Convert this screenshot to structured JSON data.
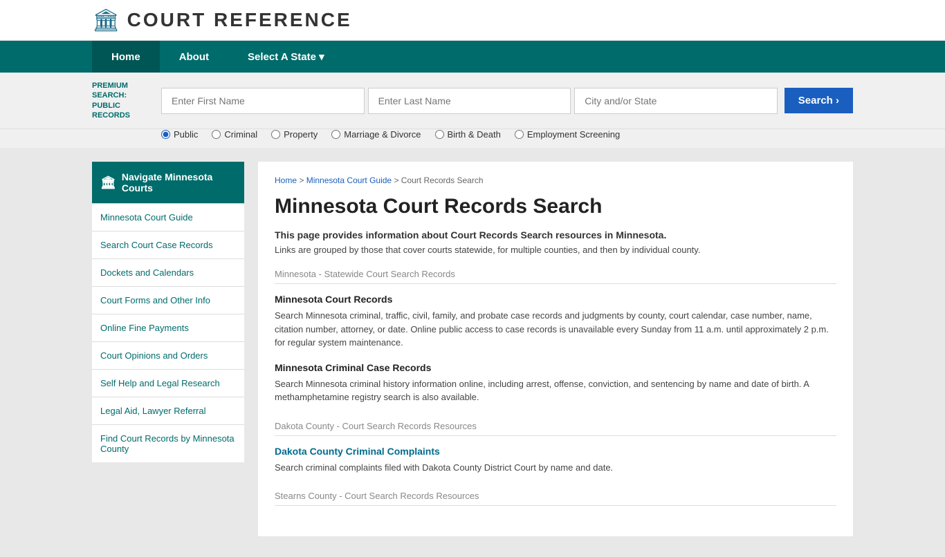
{
  "header": {
    "logo_icon": "🏛",
    "logo_text": "COURT REFERENCE"
  },
  "nav": {
    "items": [
      {
        "label": "Home",
        "active": true
      },
      {
        "label": "About",
        "active": false
      },
      {
        "label": "Select A State ▾",
        "active": false
      }
    ]
  },
  "search_bar": {
    "premium_label": "PREMIUM SEARCH: PUBLIC RECORDS",
    "first_name_placeholder": "Enter First Name",
    "last_name_placeholder": "Enter Last Name",
    "city_state_placeholder": "City and/or State",
    "search_button": "Search ›",
    "radio_options": [
      {
        "label": "Public",
        "checked": true
      },
      {
        "label": "Criminal",
        "checked": false
      },
      {
        "label": "Property",
        "checked": false
      },
      {
        "label": "Marriage & Divorce",
        "checked": false
      },
      {
        "label": "Birth & Death",
        "checked": false
      },
      {
        "label": "Employment Screening",
        "checked": false
      }
    ]
  },
  "breadcrumb": {
    "home": "Home",
    "state_guide": "Minnesota Court Guide",
    "current": "Court Records Search"
  },
  "page_title": "Minnesota Court Records Search",
  "intro": {
    "bold": "This page provides information about Court Records Search resources in Minnesota.",
    "text": "Links are grouped by those that cover courts statewide, for multiple counties, and then by individual county."
  },
  "sections": [
    {
      "header": "Minnesota - Statewide Court Search Records",
      "items": [
        {
          "title": "Minnesota Court Records",
          "link": false,
          "desc": "Search Minnesota criminal, traffic, civil, family, and probate case records and judgments by county, court calendar, case number, name, citation number, attorney, or date. Online public access to case records is unavailable every Sunday from 11 a.m. until approximately 2 p.m. for regular system maintenance."
        },
        {
          "title": "Minnesota Criminal Case Records",
          "link": false,
          "desc": "Search Minnesota criminal history information online, including arrest, offense, conviction, and sentencing by name and date of birth. A methamphetamine registry search is also available."
        }
      ]
    },
    {
      "header": "Dakota County - Court Search Records Resources",
      "items": [
        {
          "title": "Dakota County Criminal Complaints",
          "link": true,
          "desc": "Search criminal complaints filed with Dakota County District Court by name and date."
        }
      ]
    },
    {
      "header": "Stearns County - Court Search Records Resources",
      "items": []
    }
  ],
  "sidebar": {
    "active_label": "Navigate Minnesota Courts",
    "links": [
      "Minnesota Court Guide",
      "Search Court Case Records",
      "Dockets and Calendars",
      "Court Forms and Other Info",
      "Online Fine Payments",
      "Court Opinions and Orders",
      "Self Help and Legal Research",
      "Legal Aid, Lawyer Referral",
      "Find Court Records by Minnesota County"
    ]
  }
}
